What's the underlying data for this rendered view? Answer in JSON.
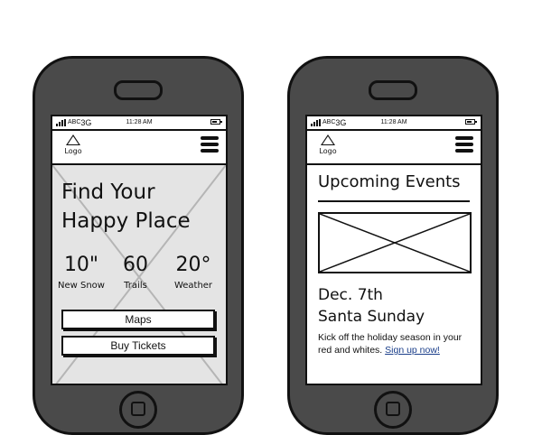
{
  "phones": {
    "left": {
      "status": {
        "carrier": "ABC",
        "network": "3G",
        "time": "11:28 AM"
      },
      "nav": {
        "logo_label": "Logo"
      },
      "hero": {
        "title_line1": "Find Your",
        "title_line2": "Happy Place"
      },
      "stats": [
        {
          "value": "10\"",
          "label": "New Snow"
        },
        {
          "value": "60",
          "label": "Trails"
        },
        {
          "value": "20°",
          "label": "Weather"
        }
      ],
      "buttons": {
        "maps": "Maps",
        "tickets": "Buy Tickets"
      }
    },
    "right": {
      "status": {
        "carrier": "ABC",
        "network": "3G",
        "time": "11:28 AM"
      },
      "nav": {
        "logo_label": "Logo"
      },
      "section_title": "Upcoming Events",
      "event": {
        "date": "Dec. 7th",
        "name": "Santa Sunday",
        "description": "Kick off the holiday season in your red and whites.",
        "link_text": "Sign up now!"
      }
    }
  },
  "icons": {
    "logo": "triangle-logo-icon",
    "menu": "hamburger-menu-icon",
    "signal": "signal-bars-icon",
    "battery": "battery-icon"
  },
  "colors": {
    "phone_body": "#4a4a4a",
    "outline": "#111111",
    "link": "#1a3e8a",
    "hero_fill": "#e4e4e4"
  }
}
